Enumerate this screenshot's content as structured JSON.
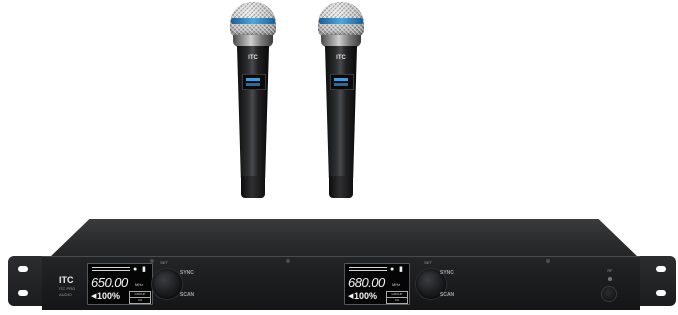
{
  "microphones": [
    {
      "logo": "ITC"
    },
    {
      "logo": "ITC"
    }
  ],
  "receiver": {
    "brand": "ITC",
    "brand_sub": "ITC PRO AUDIO",
    "channels": [
      {
        "frequency": "650.00",
        "unit": "MHz",
        "level": "100%",
        "tag_top": "GROUP",
        "tag_bottom": "CH",
        "knob_label": "SET",
        "sync_label": "SYNC",
        "scan_label": "SCAN"
      },
      {
        "frequency": "680.00",
        "unit": "MHz",
        "level": "100%",
        "tag_top": "GROUP",
        "tag_bottom": "CH",
        "knob_label": "SET",
        "sync_label": "SYNC",
        "scan_label": "SCAN"
      }
    ],
    "power_label": "RF"
  },
  "colors": {
    "mic_ring": "#4ea9e0",
    "panel": "#141516",
    "lcd_text": "#f2f2f2"
  }
}
